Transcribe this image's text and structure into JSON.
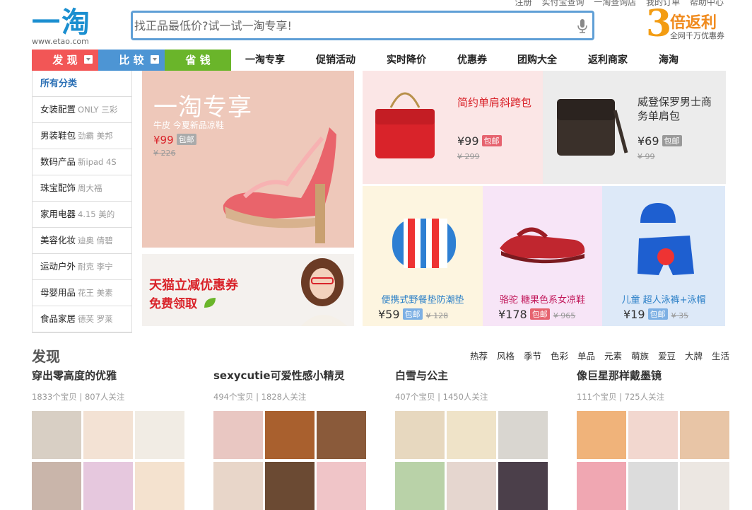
{
  "top": {
    "links": [
      "注册",
      "实付宝查询",
      "一淘查询店",
      "我的订单",
      "帮助中心"
    ]
  },
  "logo": {
    "mark": "一淘",
    "url": "www.etao.com"
  },
  "search": {
    "placeholder": "找正品最低价?试一试一淘专享!"
  },
  "rebate": {
    "number": "3",
    "text": "倍返利",
    "sub": "全网千万优惠券"
  },
  "nav": {
    "buttons": [
      {
        "label": "发 现",
        "color": "#f25656"
      },
      {
        "label": "比 较",
        "color": "#4d95d4"
      },
      {
        "label": "省 钱",
        "color": "#6ab52a"
      }
    ],
    "items": [
      "一淘专享",
      "促销活动",
      "实时降价",
      "优惠券",
      "团购大全",
      "返利商家",
      "海淘"
    ]
  },
  "sidebar": {
    "heading": "所有分类",
    "items": [
      {
        "label": "女装配置",
        "sub": "ONLY 三彩"
      },
      {
        "label": "男装鞋包",
        "sub": "劲霸 美邦"
      },
      {
        "label": "数码产品",
        "sub": "新ipad 4S"
      },
      {
        "label": "珠宝配饰",
        "sub": "周大福"
      },
      {
        "label": "家用电器",
        "sub": "4.15 美的"
      },
      {
        "label": "美容化妆",
        "sub": "迪奥 倩碧"
      },
      {
        "label": "运动户外",
        "sub": "耐克 李宁"
      },
      {
        "label": "母婴用品",
        "sub": "花王 美素"
      },
      {
        "label": "食品家居",
        "sub": "德芙 罗莱"
      }
    ]
  },
  "hero": {
    "title": "一淘专享",
    "sub": "牛皮 今夏新品凉鞋",
    "price": "¥99",
    "badge": "包邮",
    "orig": "¥ 226"
  },
  "tmall": {
    "title": "天猫立减优惠券",
    "sub": "免费领取"
  },
  "products": {
    "bag1": {
      "title": "简约单肩斜跨包",
      "price": "¥99",
      "badge": "包邮",
      "orig": "¥ 299"
    },
    "bag2": {
      "title": "威登保罗男士商务单肩包",
      "price": "¥69",
      "badge": "包邮",
      "orig": "¥ 99"
    },
    "mat": {
      "title": "便携式野餐垫防潮垫",
      "price": "¥59",
      "badge": "包邮",
      "orig": "¥ 128"
    },
    "sandal": {
      "title": "骆驼  糖果色系女凉鞋",
      "price": "¥178",
      "badge": "包邮",
      "orig": "¥ 965"
    },
    "kid": {
      "title": "儿童 超人泳裤+泳帽",
      "price": "¥19",
      "badge": "包邮",
      "orig": "¥ 35"
    }
  },
  "discover": {
    "title": "发现",
    "tags": [
      "热荐",
      "风格",
      "季节",
      "色彩",
      "单品",
      "元素",
      "萌族",
      "爱豆",
      "大牌",
      "生活"
    ],
    "collections": [
      {
        "title": "穿出零高度的优雅",
        "meta": "1833个宝贝 | 807人关注"
      },
      {
        "title": "sexycutie可爱性感小精灵",
        "meta": "494个宝贝 | 1828人关注"
      },
      {
        "title": "白雪与公主",
        "meta": "407个宝贝 | 1450人关注"
      },
      {
        "title": "像巨星那样戴墨镜",
        "meta": "111个宝贝 | 725人关注"
      }
    ]
  },
  "colors": {
    "accent_blue": "#1b8fd0",
    "price_red": "#d9232a",
    "badge_red": "#e6636f",
    "badge_blue": "#7db0e4",
    "badge_gray": "#999"
  }
}
